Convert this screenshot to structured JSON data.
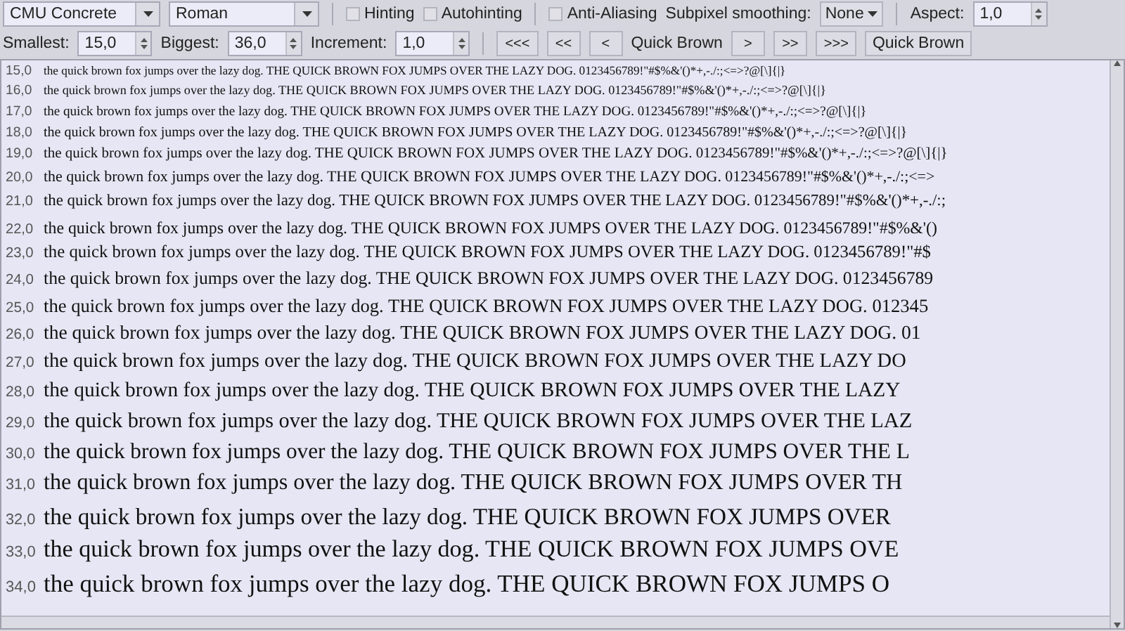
{
  "toolbar": {
    "font_family": {
      "value": "CMU Concrete"
    },
    "font_style": {
      "value": "Roman"
    },
    "hinting_options": [
      {
        "label": "Hinting",
        "checked": false
      },
      {
        "label": "Autohinting",
        "checked": false
      }
    ],
    "antialiasing": {
      "label": "Anti-Aliasing",
      "checked": false
    },
    "subpixel_smoothing": {
      "label": "Subpixel smoothing:",
      "value": "None"
    },
    "aspect": {
      "label": "Aspect:",
      "value": "1,0"
    },
    "spinners": [
      {
        "label": "Smallest:",
        "value": "15,0"
      },
      {
        "label": "Biggest:",
        "value": "36,0"
      },
      {
        "label": "Increment:",
        "value": "1,0"
      }
    ],
    "back_buttons": [
      "<<<",
      "<<",
      "<"
    ],
    "sample_label": "Quick Brown",
    "forward_buttons": [
      ">",
      ">>",
      ">>>"
    ],
    "sample_button": "Quick Brown"
  },
  "preview": {
    "rows": [
      {
        "size": "15,0",
        "text": "the quick brown fox jumps over the lazy dog. THE QUICK BROWN FOX JUMPS OVER THE LAZY DOG. 0123456789!\"#$%&'()*+,-./:;<=>?@[\\]{|}"
      },
      {
        "size": "16,0",
        "text": "the quick brown fox jumps over the lazy dog. THE QUICK BROWN FOX JUMPS OVER THE LAZY DOG. 0123456789!\"#$%&'()*+,-./:;<=>?@[\\]{|}"
      },
      {
        "size": "17,0",
        "text": "the quick brown fox jumps over the lazy dog. THE QUICK BROWN FOX JUMPS OVER THE LAZY DOG. 0123456789!\"#$%&'()*+,-./:;<=>?@[\\]{|}"
      },
      {
        "size": "18,0",
        "text": "the quick brown fox jumps over the lazy dog. THE QUICK BROWN FOX JUMPS OVER THE LAZY DOG. 0123456789!\"#$%&'()*+,-./:;<=>?@[\\]{|}"
      },
      {
        "size": "19,0",
        "text": "the quick brown fox jumps over the lazy dog. THE QUICK BROWN FOX JUMPS OVER THE LAZY DOG. 0123456789!\"#$%&'()*+,-./:;<=>?@[\\]{|}"
      },
      {
        "size": "20,0",
        "text": "the quick brown fox jumps over the lazy dog. THE QUICK BROWN FOX JUMPS OVER THE LAZY DOG. 0123456789!\"#$%&'()*+,-./:;<=>"
      },
      {
        "size": "21,0",
        "text": "the quick brown fox jumps over the lazy dog. THE QUICK BROWN FOX JUMPS OVER THE LAZY DOG. 0123456789!\"#$%&'()*+,-./:;"
      },
      {
        "size": "22,0",
        "text": "the quick brown fox jumps over the lazy dog. THE QUICK BROWN FOX JUMPS OVER THE LAZY DOG. 0123456789!\"#$%&'()"
      },
      {
        "size": "23,0",
        "text": "the quick brown fox jumps over the lazy dog. THE QUICK BROWN FOX JUMPS OVER THE LAZY DOG. 0123456789!\"#$"
      },
      {
        "size": "24,0",
        "text": "the quick brown fox jumps over the lazy dog. THE QUICK BROWN FOX JUMPS OVER THE LAZY DOG. 0123456789"
      },
      {
        "size": "25,0",
        "text": "the quick brown fox jumps over the lazy dog. THE QUICK BROWN FOX JUMPS OVER THE LAZY DOG. 012345"
      },
      {
        "size": "26,0",
        "text": "the quick brown fox jumps over the lazy dog. THE QUICK BROWN FOX JUMPS OVER THE LAZY DOG. 01"
      },
      {
        "size": "27,0",
        "text": "the quick brown fox jumps over the lazy dog. THE QUICK BROWN FOX JUMPS OVER THE LAZY DO"
      },
      {
        "size": "28,0",
        "text": "the quick brown fox jumps over the lazy dog. THE QUICK BROWN FOX JUMPS OVER THE LAZY"
      },
      {
        "size": "29,0",
        "text": "the quick brown fox jumps over the lazy dog. THE QUICK BROWN FOX JUMPS OVER THE LAZ"
      },
      {
        "size": "30,0",
        "text": "the quick brown fox jumps over the lazy dog. THE QUICK BROWN FOX JUMPS OVER THE L"
      },
      {
        "size": "31,0",
        "text": "the quick brown fox jumps over the lazy dog. THE QUICK BROWN FOX JUMPS OVER TH"
      },
      {
        "size": "32,0",
        "text": "the quick brown fox jumps over the lazy dog. THE QUICK BROWN FOX JUMPS OVER"
      },
      {
        "size": "33,0",
        "text": "the quick brown fox jumps over the lazy dog. THE QUICK BROWN FOX JUMPS OVE"
      },
      {
        "size": "34,0",
        "text": "the quick brown fox jumps over the lazy dog. THE QUICK BROWN FOX JUMPS O"
      }
    ]
  }
}
